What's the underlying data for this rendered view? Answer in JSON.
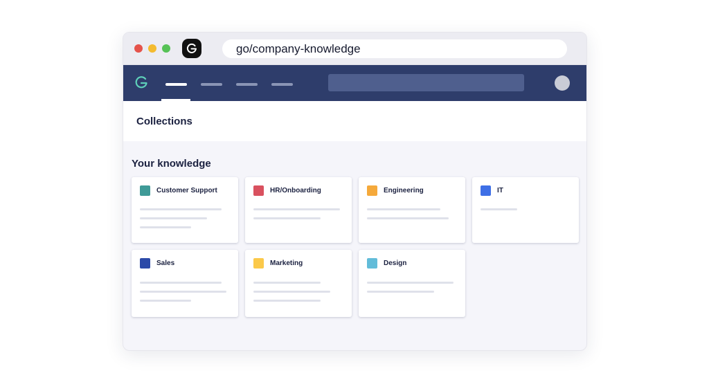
{
  "browser": {
    "url": "go/company-knowledge",
    "traffic_lights": {
      "close": "#e5534b",
      "minimize": "#f4bb2f",
      "maximize": "#56c256"
    }
  },
  "navbar": {
    "background": "#2e3d6b",
    "logo_icon": "guru-logo-icon",
    "search_placeholder": ""
  },
  "page": {
    "title": "Collections",
    "section_title": "Your knowledge"
  },
  "collections": [
    {
      "label": "Customer Support",
      "color": "#3f9a97"
    },
    {
      "label": "HR/Onboarding",
      "color": "#d9515f"
    },
    {
      "label": "Engineering",
      "color": "#f5a93b"
    },
    {
      "label": "IT",
      "color": "#3e6fe6"
    },
    {
      "label": "Sales",
      "color": "#2c4aa8"
    },
    {
      "label": "Marketing",
      "color": "#fbc94a"
    },
    {
      "label": "Design",
      "color": "#62bcd9"
    }
  ]
}
